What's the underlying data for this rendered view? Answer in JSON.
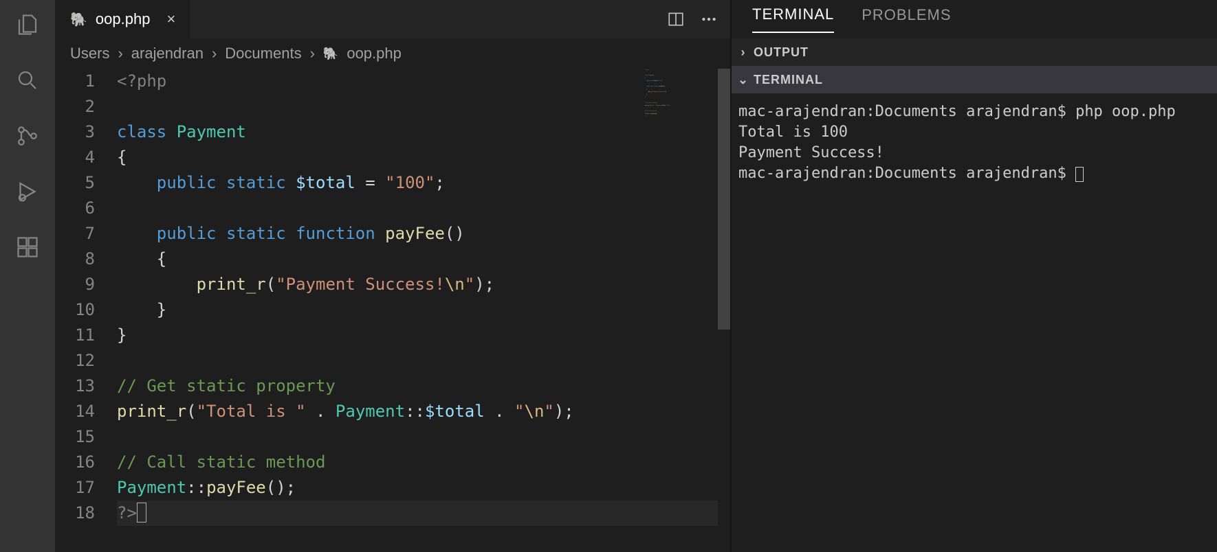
{
  "activity": {
    "icons": [
      "files-icon",
      "search-icon",
      "source-control-icon",
      "run-debug-icon",
      "extensions-icon"
    ]
  },
  "tab": {
    "filename": "oop.php",
    "language_icon": "php-icon"
  },
  "editor_actions": {
    "split": "split-editor-icon",
    "more": "more-icon"
  },
  "breadcrumbs": {
    "items": [
      "Users",
      "arajendran",
      "Documents",
      "oop.php"
    ]
  },
  "code": {
    "line_count": 18,
    "cursor_line": 18,
    "tokens": [
      [
        {
          "c": "tk-tag",
          "t": "<?php"
        }
      ],
      [],
      [
        {
          "c": "tk-kw",
          "t": "class"
        },
        {
          "c": "tk-op",
          "t": " "
        },
        {
          "c": "tk-type",
          "t": "Payment"
        }
      ],
      [
        {
          "c": "tk-pun",
          "t": "{"
        }
      ],
      [
        {
          "c": "tk-op",
          "t": "    "
        },
        {
          "c": "tk-kw",
          "t": "public"
        },
        {
          "c": "tk-op",
          "t": " "
        },
        {
          "c": "tk-kw",
          "t": "static"
        },
        {
          "c": "tk-op",
          "t": " "
        },
        {
          "c": "tk-var",
          "t": "$total"
        },
        {
          "c": "tk-op",
          "t": " = "
        },
        {
          "c": "tk-str",
          "t": "\"100\""
        },
        {
          "c": "tk-pun",
          "t": ";"
        }
      ],
      [],
      [
        {
          "c": "tk-op",
          "t": "    "
        },
        {
          "c": "tk-kw",
          "t": "public"
        },
        {
          "c": "tk-op",
          "t": " "
        },
        {
          "c": "tk-kw",
          "t": "static"
        },
        {
          "c": "tk-op",
          "t": " "
        },
        {
          "c": "tk-kw",
          "t": "function"
        },
        {
          "c": "tk-op",
          "t": " "
        },
        {
          "c": "tk-fn",
          "t": "payFee"
        },
        {
          "c": "tk-pun",
          "t": "()"
        }
      ],
      [
        {
          "c": "tk-op",
          "t": "    "
        },
        {
          "c": "tk-pun",
          "t": "{"
        }
      ],
      [
        {
          "c": "tk-op",
          "t": "        "
        },
        {
          "c": "tk-fn",
          "t": "print_r"
        },
        {
          "c": "tk-pun",
          "t": "("
        },
        {
          "c": "tk-str",
          "t": "\"Payment Success!"
        },
        {
          "c": "tk-esc",
          "t": "\\n"
        },
        {
          "c": "tk-str",
          "t": "\""
        },
        {
          "c": "tk-pun",
          "t": ");"
        }
      ],
      [
        {
          "c": "tk-op",
          "t": "    "
        },
        {
          "c": "tk-pun",
          "t": "}"
        }
      ],
      [
        {
          "c": "tk-pun",
          "t": "}"
        }
      ],
      [],
      [
        {
          "c": "tk-cmt",
          "t": "// Get static property"
        }
      ],
      [
        {
          "c": "tk-fn",
          "t": "print_r"
        },
        {
          "c": "tk-pun",
          "t": "("
        },
        {
          "c": "tk-str",
          "t": "\"Total is \""
        },
        {
          "c": "tk-op",
          "t": " . "
        },
        {
          "c": "tk-type",
          "t": "Payment"
        },
        {
          "c": "tk-pun",
          "t": "::"
        },
        {
          "c": "tk-var",
          "t": "$total"
        },
        {
          "c": "tk-op",
          "t": " . "
        },
        {
          "c": "tk-str",
          "t": "\""
        },
        {
          "c": "tk-esc",
          "t": "\\n"
        },
        {
          "c": "tk-str",
          "t": "\""
        },
        {
          "c": "tk-pun",
          "t": ");"
        }
      ],
      [],
      [
        {
          "c": "tk-cmt",
          "t": "// Call static method"
        }
      ],
      [
        {
          "c": "tk-type",
          "t": "Payment"
        },
        {
          "c": "tk-pun",
          "t": "::"
        },
        {
          "c": "tk-fn",
          "t": "payFee"
        },
        {
          "c": "tk-pun",
          "t": "();"
        }
      ],
      [
        {
          "c": "tk-tag",
          "t": "?>"
        }
      ]
    ]
  },
  "panel": {
    "tabs": {
      "terminal": "TERMINAL",
      "problems": "PROBLEMS"
    },
    "sections": {
      "output": "OUTPUT",
      "terminal": "TERMINAL"
    }
  },
  "terminal": {
    "lines": [
      "mac-arajendran:Documents arajendran$ php oop.php",
      "Total is 100",
      "Payment Success!",
      "mac-arajendran:Documents arajendran$ "
    ]
  }
}
